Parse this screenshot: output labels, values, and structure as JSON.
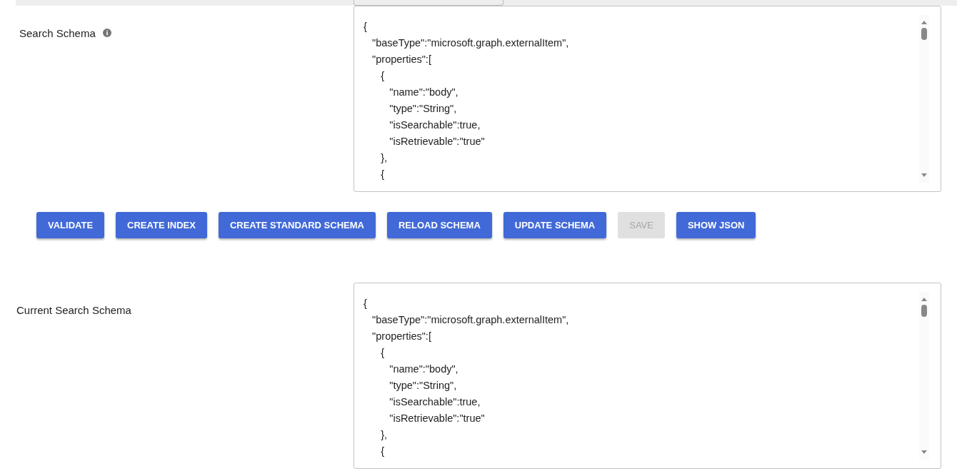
{
  "schema_sections": [
    {
      "label": "Search Schema",
      "info_icon": true,
      "code": "{\n   \"baseType\":\"microsoft.graph.externalItem\",\n   \"properties\":[\n      {\n         \"name\":\"body\",\n         \"type\":\"String\",\n         \"isSearchable\":true,\n         \"isRetrievable\":\"true\"\n      },\n      {"
    },
    {
      "label": "Current Search Schema",
      "info_icon": false,
      "code": "{\n   \"baseType\":\"microsoft.graph.externalItem\",\n   \"properties\":[\n      {\n         \"name\":\"body\",\n         \"type\":\"String\",\n         \"isSearchable\":true,\n         \"isRetrievable\":\"true\"\n      },\n      {"
    }
  ],
  "buttons": [
    {
      "label": "VALIDATE",
      "disabled": false
    },
    {
      "label": "CREATE INDEX",
      "disabled": false
    },
    {
      "label": "CREATE STANDARD SCHEMA",
      "disabled": false
    },
    {
      "label": "RELOAD SCHEMA",
      "disabled": false
    },
    {
      "label": "UPDATE SCHEMA",
      "disabled": false
    },
    {
      "label": "SAVE",
      "disabled": true
    },
    {
      "label": "SHOW JSON",
      "disabled": false
    }
  ]
}
